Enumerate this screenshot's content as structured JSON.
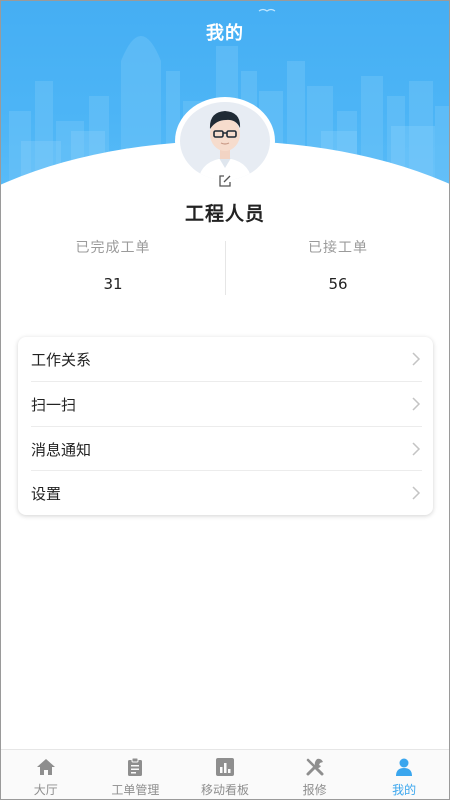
{
  "header": {
    "title": "我的"
  },
  "profile": {
    "name": "工程人员",
    "avatar_icon": "user-avatar-glasses",
    "edit_icon": "edit-icon"
  },
  "stats": [
    {
      "label": "已完成工单",
      "value": "31"
    },
    {
      "label": "已接工单",
      "value": "56"
    }
  ],
  "menu": {
    "items": [
      {
        "label": "工作关系",
        "icon": "chevron-right-icon"
      },
      {
        "label": "扫一扫",
        "icon": "chevron-right-icon"
      },
      {
        "label": "消息通知",
        "icon": "chevron-right-icon"
      },
      {
        "label": "设置",
        "icon": "chevron-right-icon"
      }
    ]
  },
  "tabbar": {
    "items": [
      {
        "label": "大厅",
        "icon": "home-icon",
        "active": false
      },
      {
        "label": "工单管理",
        "icon": "clipboard-icon",
        "active": false
      },
      {
        "label": "移动看板",
        "icon": "chart-icon",
        "active": false
      },
      {
        "label": "报修",
        "icon": "tools-icon",
        "active": false
      },
      {
        "label": "我的",
        "icon": "person-icon",
        "active": true
      }
    ]
  },
  "colors": {
    "primary": "#45aef3",
    "tab_active": "#3aa6ee",
    "tab_inactive": "#8e8e8e",
    "stat_label": "#9b9b9b"
  }
}
